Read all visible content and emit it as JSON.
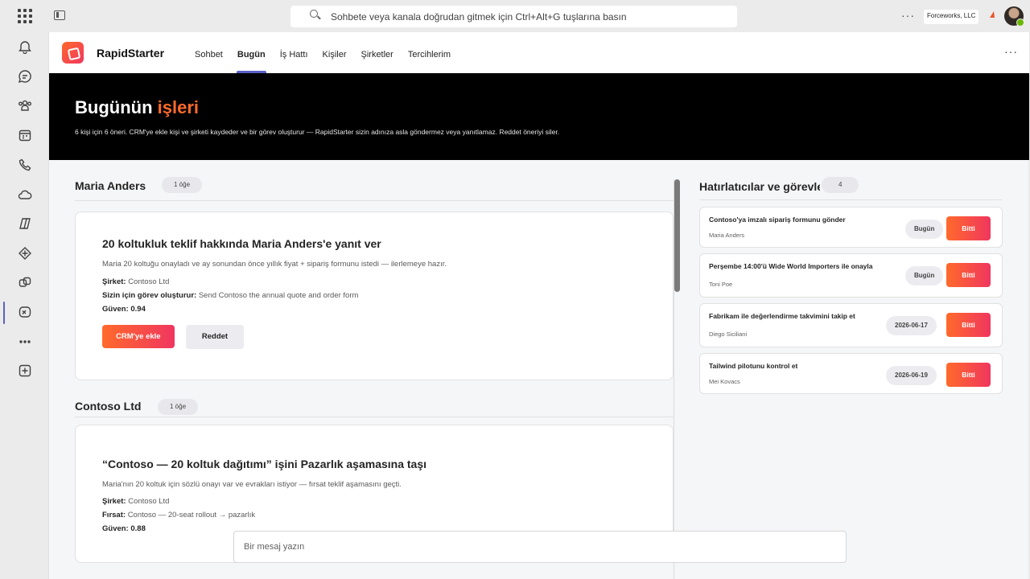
{
  "search": {
    "placeholder": "Sohbete veya kanala doğrudan gitmek için Ctrl+Alt+G tuşlarına basın"
  },
  "account": {
    "org": "Forceworks, LLC"
  },
  "app": {
    "name": "RapidStarter",
    "tabs": [
      {
        "label": "Sohbet",
        "active": false
      },
      {
        "label": "Bugün",
        "active": true
      },
      {
        "label": "İş Hattı",
        "active": false
      },
      {
        "label": "Kişiler",
        "active": false
      },
      {
        "label": "Şirketler",
        "active": false
      },
      {
        "label": "Tercihlerim",
        "active": false
      }
    ]
  },
  "hero": {
    "title_main": "Bugünün",
    "title_accent": "işleri",
    "subtitle": "6 kişi için 6 öneri. CRM'ye ekle kişi ve şirketi kaydeder ve bir görev oluşturur — RapidStarter sizin adınıza asla göndermez veya yanıtlamaz. Reddet öneriyi siler."
  },
  "sections": [
    {
      "title": "Maria Anders",
      "count": "1 öğe",
      "card": {
        "title": "20 koltukluk teklif hakkında Maria Anders'e yanıt ver",
        "description": "Maria 20 koltuğu onayladı ve ay sonundan önce yıllık fiyat + sipariş formunu istedi — ilerlemeye hazır.",
        "company_label": "Şirket:",
        "company": "Contoso Ltd",
        "task_label": "Sizin için görev oluşturur:",
        "task": "Send Contoso the annual quote and order form",
        "confidence_label": "Güven:",
        "confidence": "0.94",
        "primary_button": "CRM'ye ekle",
        "secondary_button": "Reddet"
      }
    },
    {
      "title": "Contoso Ltd",
      "count": "1 öğe",
      "card": {
        "title": "“Contoso — 20 koltuk dağıtımı” işini Pazarlık aşamasına taşı",
        "description": "Maria'nın 20 koltuk için sözlü onayı var ve evrakları istiyor — fırsat teklif aşamasını geçti.",
        "company_label": "Şirket:",
        "company": "Contoso Ltd",
        "opportunity_label": "Fırsat:",
        "opportunity": "Contoso — 20-seat rollout → pazarlık",
        "confidence_label": "Güven:",
        "confidence": "0.88"
      }
    }
  ],
  "reminders": {
    "title": "Hatırlatıcılar ve görevler",
    "count": "4",
    "done_label": "Bitti",
    "items": [
      {
        "title": "Contoso'ya imzalı sipariş formunu gönder",
        "person": "Maria Anders",
        "due": "Bugün"
      },
      {
        "title": "Perşembe 14:00'ü Wide World Importers ile onayla",
        "person": "Toni Poe",
        "due": "Bugün"
      },
      {
        "title": "Fabrikam ile değerlendirme takvimini takip et",
        "person": "Diego Siciliani",
        "due": "2026-06-17"
      },
      {
        "title": "Tailwind pilotunu kontrol et",
        "person": "Mei Kovacs",
        "due": "2026-06-19"
      }
    ]
  },
  "compose": {
    "placeholder": "Bir mesaj yazın"
  },
  "colors": {
    "accent_start": "#ff6a2b",
    "accent_end": "#f0365f",
    "teams_purple": "#5b5fc7",
    "hero_bg": "#000000"
  }
}
